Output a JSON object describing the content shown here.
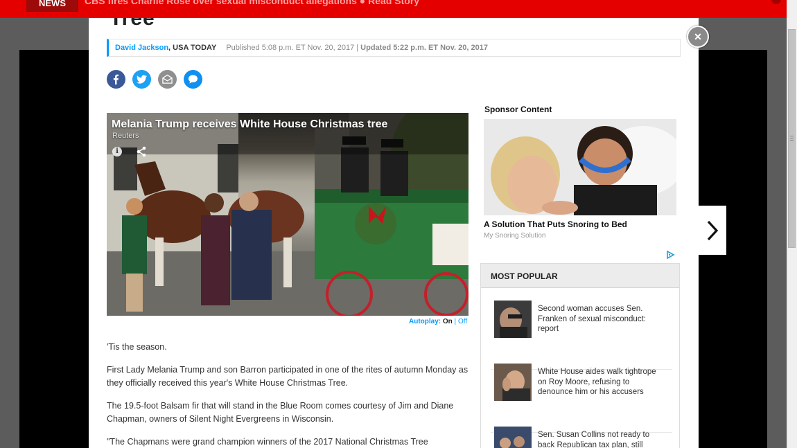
{
  "topbar": {
    "news_label": "NEWS",
    "breaking_text": "CBS fires Charlie Rose over sexual misconduct allegations  ●  Read Story"
  },
  "article": {
    "title_fragment": "Tree",
    "byline": {
      "author": "David Jackson",
      "org": ", USA TODAY",
      "published": "Published 5:08 p.m. ET Nov. 20, 2017 | ",
      "updated": "Updated 5:22 p.m. ET Nov. 20, 2017"
    },
    "share_icons": [
      "facebook-icon",
      "twitter-icon",
      "email-icon",
      "comment-icon"
    ],
    "video": {
      "title": "Melania Trump receives White House Christmas tree",
      "source": "Reuters",
      "info_glyph": "i",
      "autoplay_label": "Autoplay:",
      "autoplay_on": "On",
      "autoplay_sep": " | ",
      "autoplay_off": "Off"
    },
    "paragraphs": [
      "'Tis the season.",
      "First Lady Melania Trump and son Barron participated in one of the rites of autumn Monday as they officially received this year's White House Christmas Tree.",
      "The 19.5-foot Balsam fir that will stand in the Blue Room comes courtesy of Jim and Diane Chapman, owners of Silent Night Evergreens in Wisconsin.",
      "\"The Chapmans were grand champion winners of the 2017 National Christmas Tree"
    ]
  },
  "sidebar": {
    "sponsor_heading": "Sponsor Content",
    "sponsor_title": "A Solution That Puts Snoring to Bed",
    "sponsor_source": "My Snoring Solution",
    "most_popular_heading": "MOST POPULAR",
    "most_popular": [
      {
        "text": "Second woman accuses Sen. Franken of sexual misconduct: report"
      },
      {
        "text": "White House aides walk tightrope on Roy Moore, refusing to denounce him or his accusers"
      },
      {
        "text": "Sen. Susan Collins not ready to back Republican tax plan, still"
      }
    ]
  },
  "controls": {
    "close_glyph": "✕"
  },
  "colors": {
    "accent": "#009bff",
    "banner_red": "#e50000",
    "facebook": "#3b5998",
    "twitter": "#1da1f2"
  }
}
